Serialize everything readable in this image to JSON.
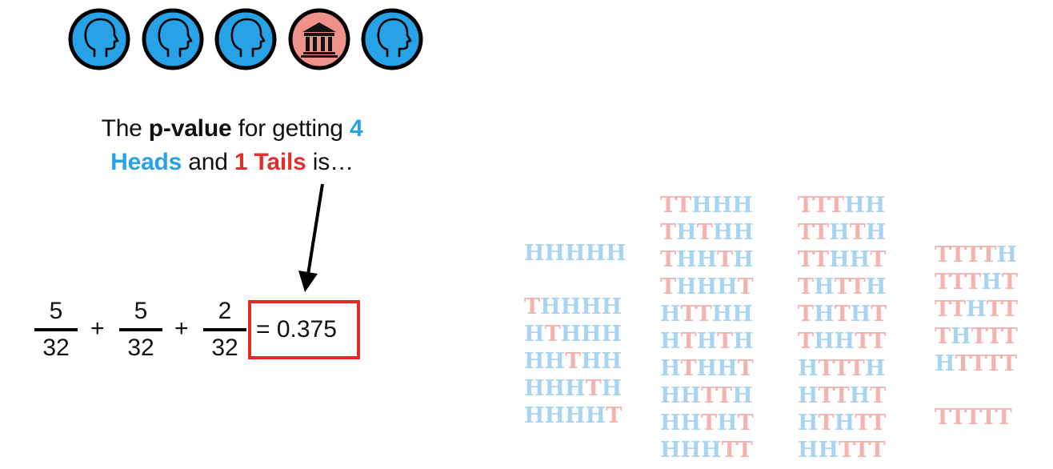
{
  "coins": [
    {
      "face": "heads",
      "icon": "head-profile-icon",
      "color": "#27a2e6"
    },
    {
      "face": "heads",
      "icon": "head-profile-icon",
      "color": "#27a2e6"
    },
    {
      "face": "heads",
      "icon": "head-profile-icon",
      "color": "#27a2e6"
    },
    {
      "face": "tails",
      "icon": "building-icon",
      "color": "#f0928c"
    },
    {
      "face": "heads",
      "icon": "head-profile-icon",
      "color": "#27a2e6"
    }
  ],
  "statement": {
    "prefix": "The ",
    "bold": "p-value",
    "middle": " for getting ",
    "heads_count": "4",
    "heads_word": "Heads",
    "and_text": " and ",
    "tails_phrase": "1 Tails",
    "suffix": " is…"
  },
  "equation": {
    "fractions": [
      {
        "numerator": "5",
        "denominator": "32"
      },
      {
        "numerator": "5",
        "denominator": "32"
      },
      {
        "numerator": "2",
        "denominator": "32"
      }
    ],
    "plus": "+",
    "result": "= 0.375"
  },
  "sequence_columns": [
    {
      "groups": [
        [
          "HHHHH"
        ],
        [
          "THHHH",
          "HTHHH",
          "HHTHH",
          "HHHTH",
          "HHHHT"
        ]
      ]
    },
    {
      "groups": [
        [
          "TTHHH",
          "THTHH",
          "THHTH",
          "THHHT",
          "HTTHH",
          "HTHTH",
          "HTHHT",
          "HHTTH",
          "HHTHT",
          "HHHTT"
        ]
      ]
    },
    {
      "groups": [
        [
          "TTTHH",
          "TTHTH",
          "TTHHT",
          "THTTH",
          "THTHT",
          "THHTT",
          "HTTTH",
          "HTTHT",
          "HTHTT",
          "HHTTT"
        ]
      ]
    },
    {
      "groups": [
        [
          "TTTTH",
          "TTTHT",
          "TTHTT",
          "THTTT",
          "HTTTT"
        ],
        [
          "TTTTT"
        ]
      ]
    }
  ],
  "colors": {
    "heads": "#27a2e6",
    "tails": "#e1302c",
    "heads_faded": "#a9d4f0",
    "tails_faded": "#f4b3b0",
    "box": "#e12b23"
  }
}
